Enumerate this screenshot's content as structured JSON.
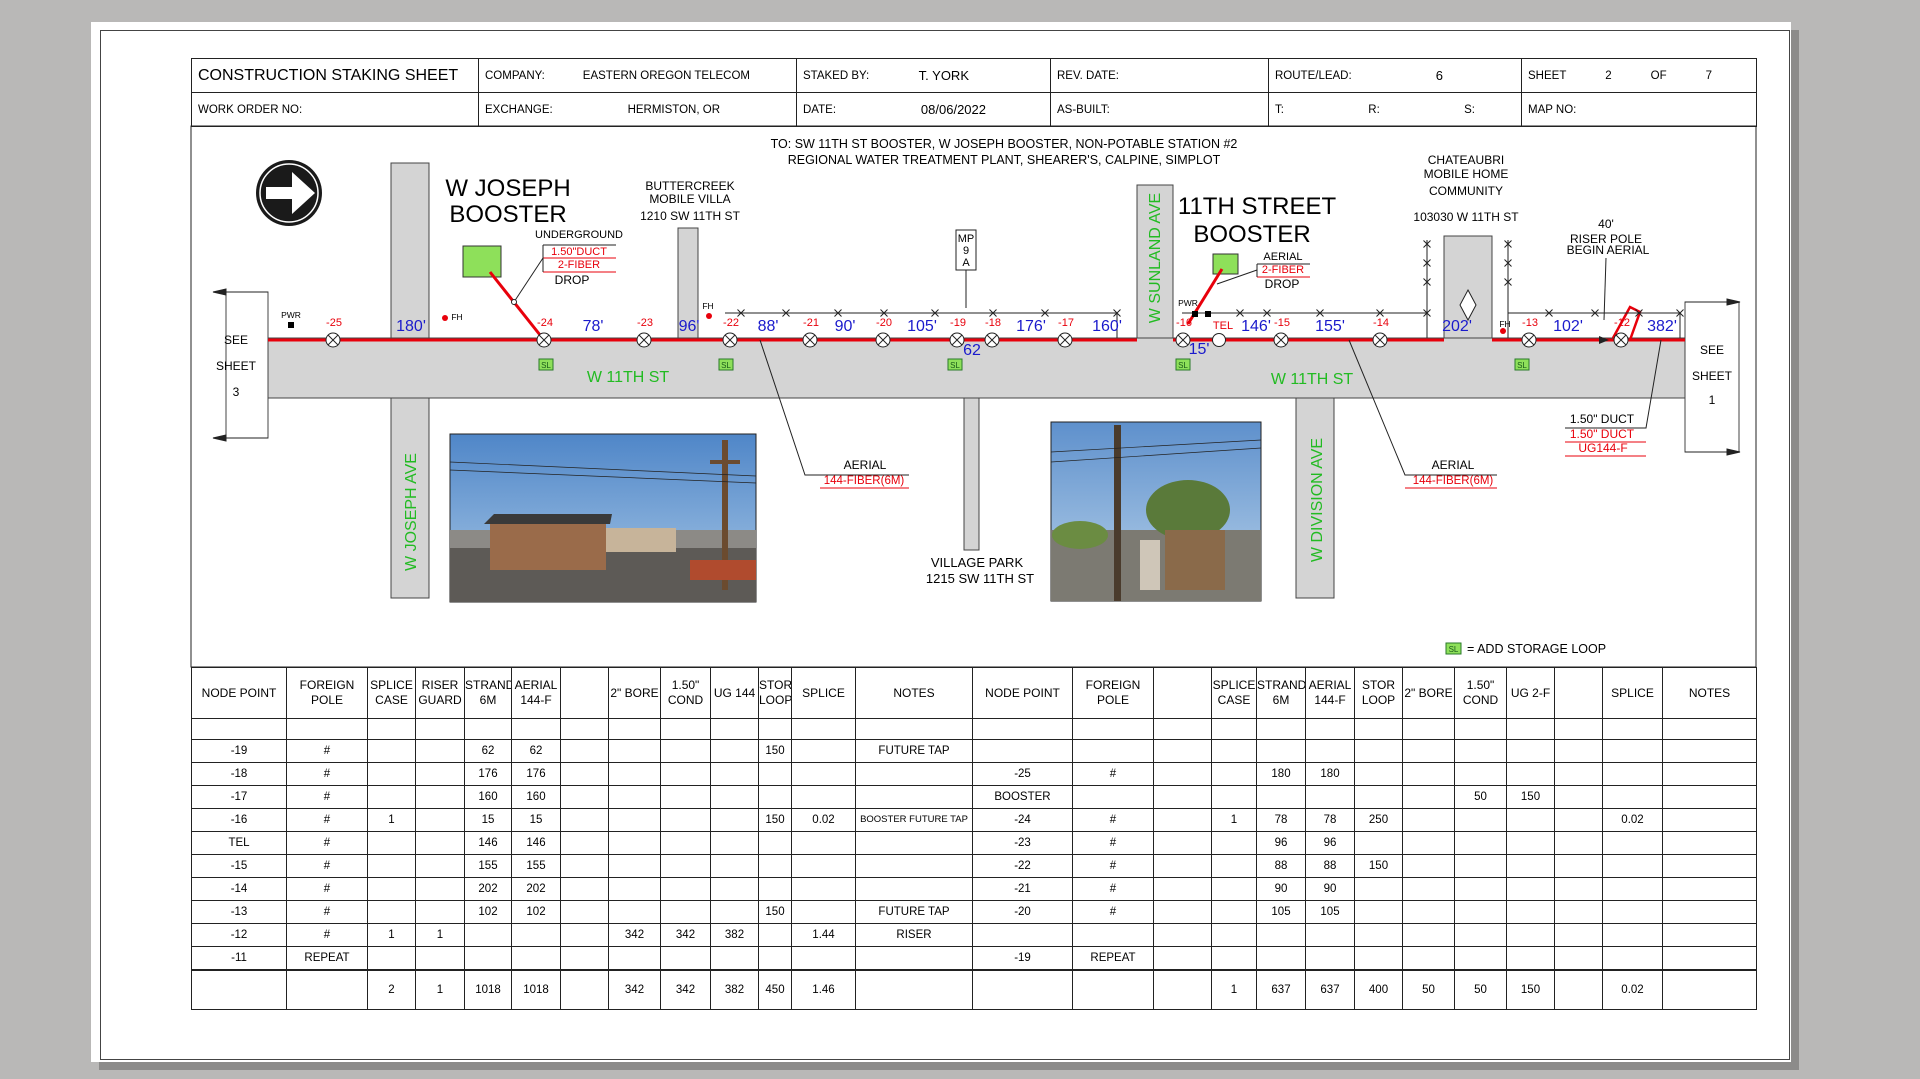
{
  "header": {
    "title": "CONSTRUCTION STAKING SHEET",
    "company_label": "COMPANY:",
    "company": "EASTERN OREGON TELECOM",
    "staked_by_label": "STAKED BY:",
    "staked_by": "T. YORK",
    "rev_date_label": "REV. DATE:",
    "route_label": "ROUTE/LEAD:",
    "route": "6",
    "sheet_label": "SHEET",
    "sheet_num": "2",
    "of_label": "OF",
    "sheet_total": "7",
    "work_order_label": "WORK ORDER NO:",
    "exchange_label": "EXCHANGE:",
    "exchange": "HERMISTON, OR",
    "date_label": "DATE:",
    "date": "08/06/2022",
    "as_built_label": "AS-BUILT:",
    "t_label": "T:",
    "r_label": "R:",
    "s_label": "S:",
    "map_label": "MAP NO:"
  },
  "map": {
    "to_line1": "TO: SW 11TH ST BOOSTER, W JOSEPH BOOSTER, NON-POTABLE STATION #2",
    "to_line2": "REGIONAL WATER TREATMENT PLANT, SHEARER'S, CALPINE, SIMPLOT",
    "joseph_booster_1": "W JOSEPH",
    "joseph_booster_2": "BOOSTER",
    "underground": "UNDERGROUND",
    "ug_duct": "1.50\"DUCT",
    "ug_fiber": "2-FIBER",
    "ug_drop": "DROP",
    "buttercreek_1": "BUTTERCREEK",
    "buttercreek_2": "MOBILE VILLA",
    "buttercreek_3": "1210 SW 11TH ST",
    "mp_1": "MP",
    "mp_2": "9",
    "mp_3": "A",
    "street_booster_1": "11TH STREET",
    "street_booster_2": "BOOSTER",
    "aerial_drop_1": "AERIAL",
    "aerial_drop_2": "2-FIBER",
    "aerial_drop_3": "DROP",
    "chateau_1": "CHATEAUBRI",
    "chateau_2": "MOBILE HOME",
    "chateau_3": "COMMUNITY",
    "chateau_4": "103030 W 11TH ST",
    "riser_1": "40'",
    "riser_2": "RISER POLE",
    "riser_3": "BEGIN AERIAL",
    "see_left_1": "SEE",
    "see_left_2": "SHEET",
    "see_left_3": "3",
    "see_right_1": "SEE",
    "see_right_2": "SHEET",
    "see_right_3": "1",
    "street_1": "W 11TH ST",
    "street_2": "W 11TH ST",
    "joseph_ave": "W JOSEPH AVE",
    "sunland_ave": "W SUNLAND AVE",
    "division_ave": "W DIVISION AVE",
    "village_1": "VILLAGE PARK",
    "village_2": "1215 SW 11TH ST",
    "aerial_a": "AERIAL",
    "aerial_a_fiber": "144-FIBER(6M)",
    "aerial_b": "AERIAL",
    "aerial_b_fiber": "144-FIBER(6M)",
    "duct_1": "1.50\" DUCT",
    "duct_2": "1.50\" DUCT",
    "duct_3": "UG144-F",
    "sl_legend": "= ADD STORAGE LOOP",
    "sl": "SL",
    "pwr": "PWR",
    "fh": "FH",
    "tel": "TEL",
    "nodes": [
      "-25",
      "-24",
      "-23",
      "-22",
      "-21",
      "-20",
      "-19",
      "-18",
      "-17",
      "-16",
      "-15",
      "-14",
      "-13",
      "-12"
    ],
    "spans": [
      "180'",
      "78'",
      "96'",
      "88'",
      "90'",
      "105'",
      "62",
      "176'",
      "160'",
      "15'",
      "146'",
      "155'",
      "202'",
      "102'",
      "382'"
    ]
  },
  "left_table": {
    "headers": [
      "NODE POINT",
      "FOREIGN POLE",
      "SPLICE CASE",
      "RISER GUARD",
      "STRAND 6M",
      "AERIAL 144-F",
      "",
      "2\" BORE",
      "1.50\" COND",
      "UG 144",
      "STOR LOOP",
      "SPLICE",
      "NOTES"
    ],
    "rows": [
      [
        "",
        "",
        "",
        "",
        "",
        "",
        "",
        "",
        "",
        "",
        "",
        "",
        ""
      ],
      [
        "-19",
        "#",
        "",
        "",
        "62",
        "62",
        "",
        "",
        "",
        "",
        "150",
        "",
        "FUTURE TAP"
      ],
      [
        "-18",
        "#",
        "",
        "",
        "176",
        "176",
        "",
        "",
        "",
        "",
        "",
        "",
        ""
      ],
      [
        "-17",
        "#",
        "",
        "",
        "160",
        "160",
        "",
        "",
        "",
        "",
        "",
        "",
        ""
      ],
      [
        "-16",
        "#",
        "1",
        "",
        "15",
        "15",
        "",
        "",
        "",
        "",
        "150",
        "0.02",
        "BOOSTER FUTURE TAP"
      ],
      [
        "TEL",
        "#",
        "",
        "",
        "146",
        "146",
        "",
        "",
        "",
        "",
        "",
        "",
        ""
      ],
      [
        "-15",
        "#",
        "",
        "",
        "155",
        "155",
        "",
        "",
        "",
        "",
        "",
        "",
        ""
      ],
      [
        "-14",
        "#",
        "",
        "",
        "202",
        "202",
        "",
        "",
        "",
        "",
        "",
        "",
        ""
      ],
      [
        "-13",
        "#",
        "",
        "",
        "102",
        "102",
        "",
        "",
        "",
        "",
        "150",
        "",
        "FUTURE TAP"
      ],
      [
        "-12",
        "#",
        "1",
        "1",
        "",
        "",
        "",
        "342",
        "342",
        "382",
        "",
        "1.44",
        "RISER"
      ],
      [
        "-11",
        "REPEAT",
        "",
        "",
        "",
        "",
        "",
        "",
        "",
        "",
        "",
        "",
        ""
      ]
    ],
    "totals": [
      "",
      "",
      "2",
      "1",
      "1018",
      "1018",
      "",
      "342",
      "342",
      "382",
      "450",
      "1.46",
      ""
    ]
  },
  "right_table": {
    "headers": [
      "NODE POINT",
      "FOREIGN POLE",
      "",
      "SPLICE CASE",
      "STRAND 6M",
      "AERIAL 144-F",
      "STOR LOOP",
      "2\" BORE",
      "1.50\" COND",
      "UG 2-F",
      "",
      "SPLICE",
      "NOTES"
    ],
    "rows": [
      [
        "",
        "",
        "",
        "",
        "",
        "",
        "",
        "",
        "",
        "",
        "",
        "",
        ""
      ],
      [
        "",
        "",
        "",
        "",
        "",
        "",
        "",
        "",
        "",
        "",
        "",
        "",
        ""
      ],
      [
        "-25",
        "#",
        "",
        "",
        "180",
        "180",
        "",
        "",
        "",
        "",
        "",
        "",
        ""
      ],
      [
        "BOOSTER",
        "",
        "",
        "",
        "",
        "",
        "",
        "",
        "50",
        "150",
        "",
        "",
        ""
      ],
      [
        "-24",
        "#",
        "",
        "1",
        "78",
        "78",
        "250",
        "",
        "",
        "",
        "",
        "0.02",
        ""
      ],
      [
        "-23",
        "#",
        "",
        "",
        "96",
        "96",
        "",
        "",
        "",
        "",
        "",
        "",
        ""
      ],
      [
        "-22",
        "#",
        "",
        "",
        "88",
        "88",
        "150",
        "",
        "",
        "",
        "",
        "",
        ""
      ],
      [
        "-21",
        "#",
        "",
        "",
        "90",
        "90",
        "",
        "",
        "",
        "",
        "",
        "",
        ""
      ],
      [
        "-20",
        "#",
        "",
        "",
        "105",
        "105",
        "",
        "",
        "",
        "",
        "",
        "",
        ""
      ],
      [
        "",
        "",
        "",
        "",
        "",
        "",
        "",
        "",
        "",
        "",
        "",
        "",
        ""
      ],
      [
        "-19",
        "REPEAT",
        "",
        "",
        "",
        "",
        "",
        "",
        "",
        "",
        "",
        "",
        ""
      ]
    ],
    "totals": [
      "",
      "",
      "",
      "1",
      "637",
      "637",
      "400",
      "50",
      "50",
      "150",
      "",
      "0.02",
      ""
    ]
  },
  "colors": {
    "fiber_line": "#e8000b",
    "span_text": "#1a1acc",
    "street_label": "#22bb22",
    "road_fill": "#d4d4d4",
    "booster_fill": "#8ee05a"
  }
}
